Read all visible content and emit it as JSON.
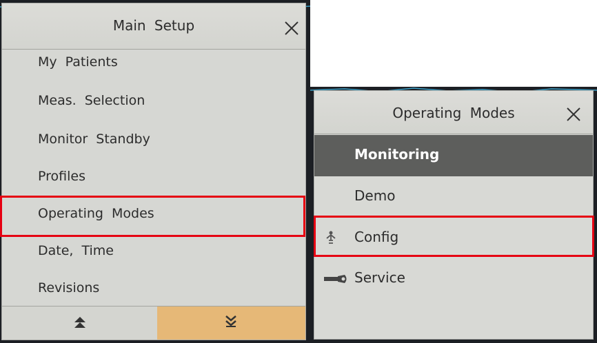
{
  "main_setup": {
    "title": "Main Setup",
    "items": [
      {
        "label": "My Patients"
      },
      {
        "label": "Meas. Selection"
      },
      {
        "label": "Monitor Standby"
      },
      {
        "label": "Profiles"
      },
      {
        "label": "Operating Modes"
      },
      {
        "label": "Date, Time"
      },
      {
        "label": "Revisions"
      }
    ],
    "highlighted_item": "Operating Modes",
    "footer": {
      "up_icon": "double-chevron-up-icon",
      "down_icon": "double-chevron-down-icon"
    }
  },
  "operating_modes": {
    "title": "Operating Modes",
    "items": [
      {
        "label": "Monitoring",
        "selected": true,
        "icon": ""
      },
      {
        "label": "Demo",
        "selected": false,
        "icon": ""
      },
      {
        "label": "Config",
        "selected": false,
        "icon": "config-person-icon"
      },
      {
        "label": "Service",
        "selected": false,
        "icon": "wrench-icon"
      }
    ],
    "highlighted_item": "Config"
  },
  "colors": {
    "highlight_box": "#e60012",
    "selected_row": "#5d5e5c",
    "page_down_button": "#e6b877",
    "panel_background": "#d6d7d3"
  }
}
